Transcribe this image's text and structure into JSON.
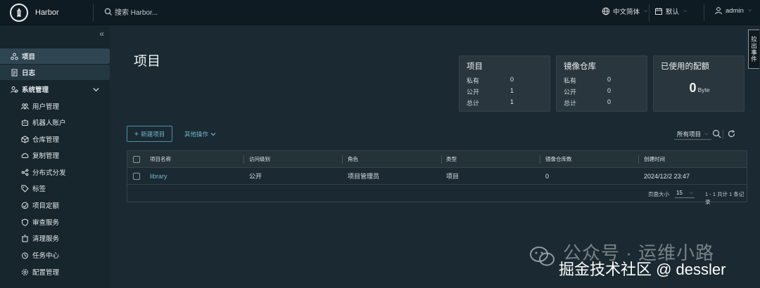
{
  "header": {
    "brand": "Harbor",
    "search_placeholder": "搜索 Harbor...",
    "language": "中文简体",
    "calendar": "默认",
    "user": "admin"
  },
  "sidebar": {
    "items": [
      {
        "label": "项目",
        "icon": "projects-icon",
        "level": "top",
        "active": true
      },
      {
        "label": "日志",
        "icon": "log-icon",
        "level": "top",
        "active": true
      },
      {
        "label": "系统管理",
        "icon": "system-admin-icon",
        "level": "top",
        "active": false
      },
      {
        "label": "用户管理",
        "icon": "users-icon",
        "level": "sub"
      },
      {
        "label": "机器人账户",
        "icon": "robot-icon",
        "level": "sub"
      },
      {
        "label": "仓库管理",
        "icon": "registry-icon",
        "level": "sub"
      },
      {
        "label": "复制管理",
        "icon": "replication-icon",
        "level": "sub"
      },
      {
        "label": "分布式分发",
        "icon": "distribution-icon",
        "level": "sub"
      },
      {
        "label": "标签",
        "icon": "tag-icon",
        "level": "sub"
      },
      {
        "label": "项目定额",
        "icon": "quota-icon",
        "level": "sub"
      },
      {
        "label": "审查服务",
        "icon": "shield-icon",
        "level": "sub"
      },
      {
        "label": "清理服务",
        "icon": "cleanup-icon",
        "level": "sub"
      },
      {
        "label": "任务中心",
        "icon": "task-icon",
        "level": "sub"
      },
      {
        "label": "配置管理",
        "icon": "gear-icon",
        "level": "sub"
      }
    ]
  },
  "page": {
    "title": "项目"
  },
  "cards": {
    "projects": {
      "title": "项目",
      "rows": [
        {
          "label": "私有",
          "value": "0"
        },
        {
          "label": "公开",
          "value": "1"
        },
        {
          "label": "总计",
          "value": "1"
        }
      ]
    },
    "repos": {
      "title": "镜像仓库",
      "rows": [
        {
          "label": "私有",
          "value": "0"
        },
        {
          "label": "公开",
          "value": "0"
        },
        {
          "label": "总计",
          "value": "0"
        }
      ]
    },
    "quota": {
      "title": "已使用的配额",
      "value": "0",
      "unit": "Byte"
    }
  },
  "toolbar": {
    "new_project": "新建项目",
    "other_actions": "其他操作",
    "filter": "所有项目"
  },
  "table": {
    "columns": [
      "项目名称",
      "访问级别",
      "角色",
      "类型",
      "镜像仓库数",
      "创建时间"
    ],
    "rows": [
      {
        "name": "library",
        "access": "公开",
        "role": "项目管理员",
        "type": "项目",
        "repo_count": "0",
        "created": "2024/12/2 23:47"
      }
    ],
    "footer": {
      "page_size_label": "页面大小",
      "page_size": "15",
      "summary": "1 - 1 共计 1 条记录"
    }
  },
  "side_tab": {
    "label": "拉出事件"
  },
  "watermark": {
    "line1": "公众号 · 运维小路",
    "line2": "掘金技术社区 @ dessler"
  }
}
